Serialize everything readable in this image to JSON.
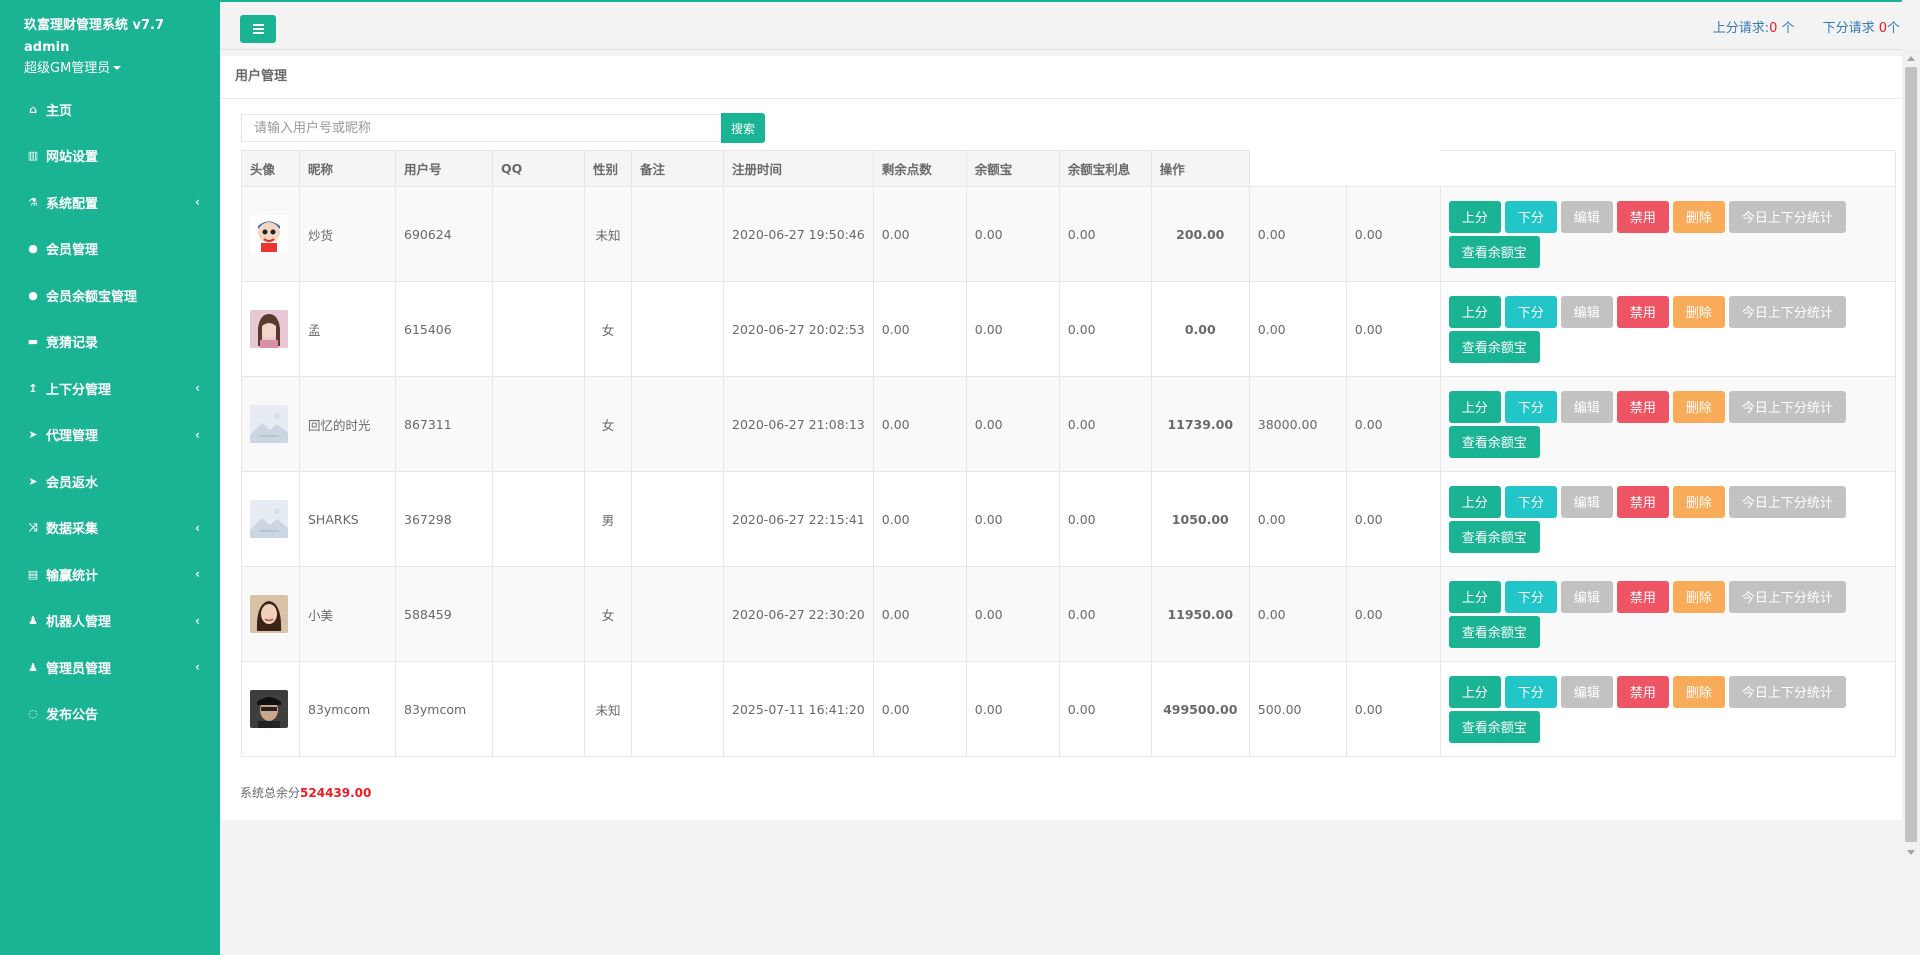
{
  "app": {
    "title": "玖富理财管理系统 v7.7",
    "username": "admin",
    "role": "超级GM管理员"
  },
  "nav": [
    {
      "label": "主页",
      "icon": "home-icon",
      "glyph": "⌂",
      "arrow": false
    },
    {
      "label": "网站设置",
      "icon": "columns-icon",
      "glyph": "▥",
      "arrow": false
    },
    {
      "label": "系统配置",
      "icon": "flask-icon",
      "glyph": "⚗",
      "arrow": true
    },
    {
      "label": "会员管理",
      "icon": "user-icon",
      "glyph": "●",
      "arrow": false
    },
    {
      "label": "会员余额宝管理",
      "icon": "user-icon",
      "glyph": "●",
      "arrow": false
    },
    {
      "label": "竞猜记录",
      "icon": "car-icon",
      "glyph": "▬",
      "arrow": false
    },
    {
      "label": "上下分管理",
      "icon": "level-up-icon",
      "glyph": "↥",
      "arrow": true
    },
    {
      "label": "代理管理",
      "icon": "paper-plane-icon",
      "glyph": "➤",
      "arrow": true
    },
    {
      "label": "会员返水",
      "icon": "paper-plane-icon",
      "glyph": "➤",
      "arrow": false
    },
    {
      "label": "数据采集",
      "icon": "random-icon",
      "glyph": "⤨",
      "arrow": true
    },
    {
      "label": "输赢统计",
      "icon": "bar-chart-icon",
      "glyph": "▤",
      "arrow": true
    },
    {
      "label": "机器人管理",
      "icon": "male-icon",
      "glyph": "♟",
      "arrow": true
    },
    {
      "label": "管理员管理",
      "icon": "male-icon",
      "glyph": "♟",
      "arrow": true
    },
    {
      "label": "发布公告",
      "icon": "comment-icon",
      "glyph": "◌",
      "arrow": false
    }
  ],
  "top": {
    "up_label": "上分请求:",
    "up_count": "0",
    "up_unit": " 个",
    "down_label": "下分请求 ",
    "down_count": "0",
    "down_unit": "个"
  },
  "page_title": "用户管理",
  "search": {
    "placeholder": "请输入用户号或昵称",
    "button": "搜索"
  },
  "table": {
    "headers": [
      "头像",
      "昵称",
      "用户号",
      "QQ",
      "性别",
      "备注",
      "注册时间",
      "剩余点数",
      "余额宝",
      "余额宝利息",
      "操作"
    ],
    "rows": [
      {
        "avatar": "cartoon",
        "nickname": "炒货",
        "uid": "690624",
        "qq": "",
        "gender": "未知",
        "note": "",
        "reg": "2020-06-27 19:50:46",
        "c1": "0.00",
        "c2": "0.00",
        "c3": "0.00",
        "score": "200.00",
        "c4": "0.00",
        "c5": "0.00"
      },
      {
        "avatar": "girl",
        "nickname": "孟",
        "uid": "615406",
        "qq": "",
        "gender": "女",
        "note": "",
        "reg": "2020-06-27 20:02:53",
        "c1": "0.00",
        "c2": "0.00",
        "c3": "0.00",
        "score": "0.00",
        "c4": "0.00",
        "c5": "0.00"
      },
      {
        "avatar": "placeholder",
        "nickname": "回忆的时光",
        "uid": "867311",
        "qq": "",
        "gender": "女",
        "note": "",
        "reg": "2020-06-27 21:08:13",
        "c1": "0.00",
        "c2": "0.00",
        "c3": "0.00",
        "score": "11739.00",
        "c4": "38000.00",
        "c5": "0.00"
      },
      {
        "avatar": "placeholder",
        "nickname": "SHARKS",
        "uid": "367298",
        "qq": "",
        "gender": "男",
        "note": "",
        "reg": "2020-06-27 22:15:41",
        "c1": "0.00",
        "c2": "0.00",
        "c3": "0.00",
        "score": "1050.00",
        "c4": "0.00",
        "c5": "0.00"
      },
      {
        "avatar": "woman",
        "nickname": "小美",
        "uid": "588459",
        "qq": "",
        "gender": "女",
        "note": "",
        "reg": "2020-06-27 22:30:20",
        "c1": "0.00",
        "c2": "0.00",
        "c3": "0.00",
        "score": "11950.00",
        "c4": "0.00",
        "c5": "0.00"
      },
      {
        "avatar": "man",
        "nickname": "83ymcom",
        "uid": "83ymcom",
        "qq": "",
        "gender": "未知",
        "note": "",
        "reg": "2025-07-11 16:41:20",
        "c1": "0.00",
        "c2": "0.00",
        "c3": "0.00",
        "score": "499500.00",
        "c4": "500.00",
        "c5": "0.00"
      }
    ],
    "actions": {
      "up": "上分",
      "down": "下分",
      "edit": "编辑",
      "ban": "禁用",
      "delete": "删除",
      "stat": "今日上下分统计",
      "view": "查看余额宝"
    }
  },
  "total": {
    "label": "系统总余分",
    "value": "524439.00"
  },
  "colors": {
    "primary": "#1ab394",
    "info": "#23c6c8",
    "danger": "#ed5565",
    "warning": "#f8ac59",
    "muted": "#c2c2c2",
    "link": "#337ab7",
    "red": "#ed1c24"
  }
}
